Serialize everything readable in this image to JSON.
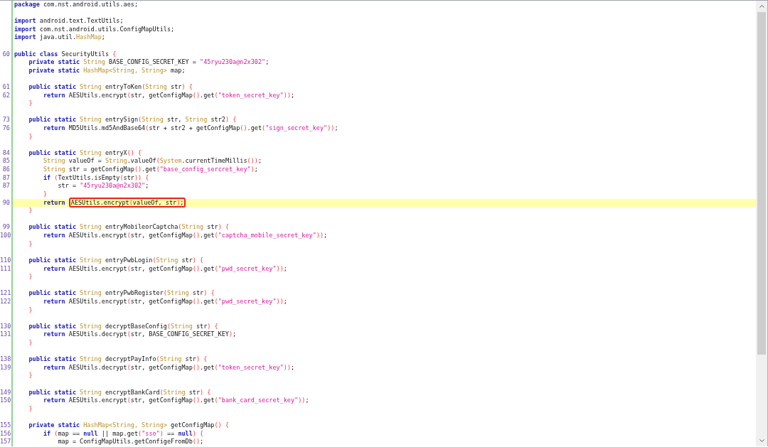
{
  "editor": {
    "blocks": [
      {
        "lines": [
          {
            "highlighted": false,
            "tokens": [
              {
                "kind": "keyword",
                "text": "package"
              },
              {
                "kind": "plain",
                "text": " com.nst.android.utils.aes;"
              }
            ]
          }
        ]
      },
      {
        "lines": [
          {
            "highlighted": false,
            "tokens": [
              {
                "kind": "keyword",
                "text": "import"
              },
              {
                "kind": "plain",
                "text": " android.text.TextUtils;"
              }
            ]
          },
          {
            "highlighted": false,
            "tokens": [
              {
                "kind": "keyword",
                "text": "import"
              },
              {
                "kind": "plain",
                "text": " com.nst.android.utils.ConfigMapUtils;"
              }
            ]
          },
          {
            "highlighted": false,
            "tokens": [
              {
                "kind": "keyword",
                "text": "import"
              },
              {
                "kind": "plain",
                "text": " java.util."
              },
              {
                "kind": "type",
                "text": "HashMap"
              },
              {
                "kind": "plain",
                "text": ";"
              }
            ]
          }
        ]
      },
      {
        "lines": [
          {
            "number": "60",
            "highlighted": false,
            "tokens": [
              {
                "kind": "keyword",
                "text": "public class"
              },
              {
                "kind": "plain",
                "text": " SecurityUtils "
              },
              {
                "kind": "bracket",
                "text": "{"
              }
            ]
          },
          {
            "highlighted": false,
            "tokens": [
              {
                "kind": "keyword",
                "text": "    private static"
              },
              {
                "kind": "type",
                "text": " String"
              },
              {
                "kind": "plain",
                "text": " BASE_CONFIG_SECRET_KEY = "
              },
              {
                "kind": "string",
                "text": "\"45ryu230a@n2x302\""
              },
              {
                "kind": "plain",
                "text": ";"
              }
            ]
          },
          {
            "highlighted": false,
            "tokens": [
              {
                "kind": "keyword",
                "text": "    private static"
              },
              {
                "kind": "type",
                "text": " HashMap<String, String>"
              },
              {
                "kind": "plain",
                "text": " map;"
              }
            ]
          }
        ]
      },
      {
        "lines": [
          {
            "number": "61",
            "highlighted": false,
            "tokens": [
              {
                "kind": "keyword",
                "text": "    public static"
              },
              {
                "kind": "type",
                "text": " String"
              },
              {
                "kind": "plain",
                "text": " entryToKen"
              },
              {
                "kind": "bracket",
                "text": "("
              },
              {
                "kind": "type",
                "text": "String"
              },
              {
                "kind": "plain",
                "text": " str"
              },
              {
                "kind": "bracket",
                "text": ") {"
              }
            ]
          },
          {
            "number": "62",
            "highlighted": false,
            "tokens": [
              {
                "kind": "keyword",
                "text": "        return"
              },
              {
                "kind": "plain",
                "text": " AESUtils.encrypt"
              },
              {
                "kind": "bracket",
                "text": "("
              },
              {
                "kind": "plain",
                "text": "str, getConfigMap"
              },
              {
                "kind": "bracket",
                "text": "()"
              },
              {
                "kind": "plain",
                "text": ".get"
              },
              {
                "kind": "bracket",
                "text": "("
              },
              {
                "kind": "string",
                "text": "\"token_secret_key\""
              },
              {
                "kind": "bracket",
                "text": "))"
              },
              {
                "kind": "plain",
                "text": ";"
              }
            ]
          },
          {
            "highlighted": false,
            "tokens": [
              {
                "kind": "bracket",
                "text": "    }"
              }
            ]
          }
        ]
      },
      {
        "lines": [
          {
            "number": "73",
            "highlighted": false,
            "tokens": [
              {
                "kind": "keyword",
                "text": "    public static"
              },
              {
                "kind": "type",
                "text": " String"
              },
              {
                "kind": "plain",
                "text": " entrySign"
              },
              {
                "kind": "bracket",
                "text": "("
              },
              {
                "kind": "type",
                "text": "String"
              },
              {
                "kind": "plain",
                "text": " str, "
              },
              {
                "kind": "type",
                "text": "String"
              },
              {
                "kind": "plain",
                "text": " str2"
              },
              {
                "kind": "bracket",
                "text": ") {"
              }
            ]
          },
          {
            "number": "76",
            "highlighted": false,
            "tokens": [
              {
                "kind": "keyword",
                "text": "        return"
              },
              {
                "kind": "plain",
                "text": " MD5Utils.md5AndBase64"
              },
              {
                "kind": "bracket",
                "text": "("
              },
              {
                "kind": "plain",
                "text": "str + str2 + getConfigMap"
              },
              {
                "kind": "bracket",
                "text": "()"
              },
              {
                "kind": "plain",
                "text": ".get"
              },
              {
                "kind": "bracket",
                "text": "("
              },
              {
                "kind": "string",
                "text": "\"sign_secret_key\""
              },
              {
                "kind": "bracket",
                "text": "))"
              },
              {
                "kind": "plain",
                "text": ";"
              }
            ]
          },
          {
            "highlighted": false,
            "tokens": [
              {
                "kind": "bracket",
                "text": "    }"
              }
            ]
          }
        ]
      },
      {
        "lines": [
          {
            "number": "84",
            "highlighted": false,
            "tokens": [
              {
                "kind": "keyword",
                "text": "    public static"
              },
              {
                "kind": "type",
                "text": " String"
              },
              {
                "kind": "plain",
                "text": " entryX"
              },
              {
                "kind": "bracket",
                "text": "() {"
              }
            ]
          },
          {
            "number": "85",
            "highlighted": false,
            "tokens": [
              {
                "kind": "type",
                "text": "        String"
              },
              {
                "kind": "plain",
                "text": " valueOf = "
              },
              {
                "kind": "type",
                "text": "String"
              },
              {
                "kind": "plain",
                "text": ".valueOf"
              },
              {
                "kind": "bracket",
                "text": "("
              },
              {
                "kind": "type",
                "text": "System"
              },
              {
                "kind": "plain",
                "text": ".currentTimeMillis"
              },
              {
                "kind": "bracket",
                "text": "())"
              },
              {
                "kind": "plain",
                "text": ";"
              }
            ]
          },
          {
            "number": "86",
            "highlighted": false,
            "tokens": [
              {
                "kind": "type",
                "text": "        String"
              },
              {
                "kind": "plain",
                "text": " str = getConfigMap"
              },
              {
                "kind": "bracket",
                "text": "()"
              },
              {
                "kind": "plain",
                "text": ".get"
              },
              {
                "kind": "bracket",
                "text": "("
              },
              {
                "kind": "string",
                "text": "\"base_config_sercret_key\""
              },
              {
                "kind": "bracket",
                "text": ")"
              },
              {
                "kind": "plain",
                "text": ";"
              }
            ]
          },
          {
            "number": "87",
            "highlighted": false,
            "tokens": [
              {
                "kind": "keyword",
                "text": "        if"
              },
              {
                "kind": "bracket",
                "text": " ("
              },
              {
                "kind": "plain",
                "text": "TextUtils.isEmpty"
              },
              {
                "kind": "bracket",
                "text": "("
              },
              {
                "kind": "plain",
                "text": "str"
              },
              {
                "kind": "bracket",
                "text": ")) {"
              }
            ]
          },
          {
            "number": "87",
            "highlighted": false,
            "tokens": [
              {
                "kind": "plain",
                "text": "            str = "
              },
              {
                "kind": "string",
                "text": "\"45ryu230a@n2x302\""
              },
              {
                "kind": "plain",
                "text": ";"
              }
            ]
          },
          {
            "highlighted": false,
            "tokens": [
              {
                "kind": "bracket",
                "text": "        }"
              }
            ]
          },
          {
            "number": "90",
            "highlighted": true,
            "tokens": [
              {
                "kind": "keyword",
                "text": "        return "
              }
            ],
            "boxed_tokens": [
              {
                "kind": "plain",
                "text": "AESUtils.encrypt"
              },
              {
                "kind": "bracket",
                "text": "("
              },
              {
                "kind": "plain",
                "text": "valueOf, str"
              },
              {
                "kind": "bracket",
                "text": ")"
              },
              {
                "kind": "plain",
                "text": ";"
              }
            ]
          },
          {
            "highlighted": false,
            "tokens": [
              {
                "kind": "bracket",
                "text": "    }"
              }
            ]
          }
        ]
      },
      {
        "lines": [
          {
            "number": "99",
            "highlighted": false,
            "tokens": [
              {
                "kind": "keyword",
                "text": "    public static"
              },
              {
                "kind": "type",
                "text": " String"
              },
              {
                "kind": "plain",
                "text": " entryMobileorCaptcha"
              },
              {
                "kind": "bracket",
                "text": "("
              },
              {
                "kind": "type",
                "text": "String"
              },
              {
                "kind": "plain",
                "text": " str"
              },
              {
                "kind": "bracket",
                "text": ") {"
              }
            ]
          },
          {
            "number": "100",
            "highlighted": false,
            "tokens": [
              {
                "kind": "keyword",
                "text": "        return"
              },
              {
                "kind": "plain",
                "text": " AESUtils.encrypt"
              },
              {
                "kind": "bracket",
                "text": "("
              },
              {
                "kind": "plain",
                "text": "str, getConfigMap"
              },
              {
                "kind": "bracket",
                "text": "()"
              },
              {
                "kind": "plain",
                "text": ".get"
              },
              {
                "kind": "bracket",
                "text": "("
              },
              {
                "kind": "string",
                "text": "\"captcha_mobile_secret_key\""
              },
              {
                "kind": "bracket",
                "text": "))"
              },
              {
                "kind": "plain",
                "text": ";"
              }
            ]
          },
          {
            "highlighted": false,
            "tokens": [
              {
                "kind": "bracket",
                "text": "    }"
              }
            ]
          }
        ]
      },
      {
        "lines": [
          {
            "number": "110",
            "highlighted": false,
            "tokens": [
              {
                "kind": "keyword",
                "text": "    public static"
              },
              {
                "kind": "type",
                "text": " String"
              },
              {
                "kind": "plain",
                "text": " entryPwbLogin"
              },
              {
                "kind": "bracket",
                "text": "("
              },
              {
                "kind": "type",
                "text": "String"
              },
              {
                "kind": "plain",
                "text": " str"
              },
              {
                "kind": "bracket",
                "text": ") {"
              }
            ]
          },
          {
            "number": "111",
            "highlighted": false,
            "tokens": [
              {
                "kind": "keyword",
                "text": "        return"
              },
              {
                "kind": "plain",
                "text": " AESUtils.encrypt"
              },
              {
                "kind": "bracket",
                "text": "("
              },
              {
                "kind": "plain",
                "text": "str, getConfigMap"
              },
              {
                "kind": "bracket",
                "text": "()"
              },
              {
                "kind": "plain",
                "text": ".get"
              },
              {
                "kind": "bracket",
                "text": "("
              },
              {
                "kind": "string",
                "text": "\"pwd_secret_key\""
              },
              {
                "kind": "bracket",
                "text": "))"
              },
              {
                "kind": "plain",
                "text": ";"
              }
            ]
          },
          {
            "highlighted": false,
            "tokens": [
              {
                "kind": "bracket",
                "text": "    }"
              }
            ]
          }
        ]
      },
      {
        "lines": [
          {
            "number": "121",
            "highlighted": false,
            "tokens": [
              {
                "kind": "keyword",
                "text": "    public static"
              },
              {
                "kind": "type",
                "text": " String"
              },
              {
                "kind": "plain",
                "text": " entryPwbRegister"
              },
              {
                "kind": "bracket",
                "text": "("
              },
              {
                "kind": "type",
                "text": "String"
              },
              {
                "kind": "plain",
                "text": " str"
              },
              {
                "kind": "bracket",
                "text": ") {"
              }
            ]
          },
          {
            "number": "122",
            "highlighted": false,
            "tokens": [
              {
                "kind": "keyword",
                "text": "        return"
              },
              {
                "kind": "plain",
                "text": " AESUtils.encrypt"
              },
              {
                "kind": "bracket",
                "text": "("
              },
              {
                "kind": "plain",
                "text": "str, getConfigMap"
              },
              {
                "kind": "bracket",
                "text": "()"
              },
              {
                "kind": "plain",
                "text": ".get"
              },
              {
                "kind": "bracket",
                "text": "("
              },
              {
                "kind": "string",
                "text": "\"pwd_secret_key\""
              },
              {
                "kind": "bracket",
                "text": "))"
              },
              {
                "kind": "plain",
                "text": ";"
              }
            ]
          },
          {
            "highlighted": false,
            "tokens": [
              {
                "kind": "bracket",
                "text": "    }"
              }
            ]
          }
        ]
      },
      {
        "lines": [
          {
            "number": "130",
            "highlighted": false,
            "tokens": [
              {
                "kind": "keyword",
                "text": "    public static"
              },
              {
                "kind": "type",
                "text": " String"
              },
              {
                "kind": "plain",
                "text": " decryptBaseConfig"
              },
              {
                "kind": "bracket",
                "text": "("
              },
              {
                "kind": "type",
                "text": "String"
              },
              {
                "kind": "plain",
                "text": " str"
              },
              {
                "kind": "bracket",
                "text": ") {"
              }
            ]
          },
          {
            "number": "131",
            "highlighted": false,
            "tokens": [
              {
                "kind": "keyword",
                "text": "        return"
              },
              {
                "kind": "plain",
                "text": " AESUtils.decrypt"
              },
              {
                "kind": "bracket",
                "text": "("
              },
              {
                "kind": "plain",
                "text": "str, BASE_CONFIG_SECRET_KEY"
              },
              {
                "kind": "bracket",
                "text": ")"
              },
              {
                "kind": "plain",
                "text": ";"
              }
            ]
          },
          {
            "highlighted": false,
            "tokens": [
              {
                "kind": "bracket",
                "text": "    }"
              }
            ]
          }
        ]
      },
      {
        "lines": [
          {
            "number": "138",
            "highlighted": false,
            "tokens": [
              {
                "kind": "keyword",
                "text": "    public static"
              },
              {
                "kind": "type",
                "text": " String"
              },
              {
                "kind": "plain",
                "text": " decryptPayInfo"
              },
              {
                "kind": "bracket",
                "text": "("
              },
              {
                "kind": "type",
                "text": "String"
              },
              {
                "kind": "plain",
                "text": " str"
              },
              {
                "kind": "bracket",
                "text": ") {"
              }
            ]
          },
          {
            "number": "139",
            "highlighted": false,
            "tokens": [
              {
                "kind": "keyword",
                "text": "        return"
              },
              {
                "kind": "plain",
                "text": " AESUtils.decrypt"
              },
              {
                "kind": "bracket",
                "text": "("
              },
              {
                "kind": "plain",
                "text": "str, getConfigMap"
              },
              {
                "kind": "bracket",
                "text": "()"
              },
              {
                "kind": "plain",
                "text": ".get"
              },
              {
                "kind": "bracket",
                "text": "("
              },
              {
                "kind": "string",
                "text": "\"token_secret_key\""
              },
              {
                "kind": "bracket",
                "text": "))"
              },
              {
                "kind": "plain",
                "text": ";"
              }
            ]
          },
          {
            "highlighted": false,
            "tokens": [
              {
                "kind": "bracket",
                "text": "    }"
              }
            ]
          }
        ]
      },
      {
        "lines": [
          {
            "number": "149",
            "highlighted": false,
            "tokens": [
              {
                "kind": "keyword",
                "text": "    public static"
              },
              {
                "kind": "type",
                "text": " String"
              },
              {
                "kind": "plain",
                "text": " encryptBankCard"
              },
              {
                "kind": "bracket",
                "text": "("
              },
              {
                "kind": "type",
                "text": "String"
              },
              {
                "kind": "plain",
                "text": " str"
              },
              {
                "kind": "bracket",
                "text": ") {"
              }
            ]
          },
          {
            "number": "150",
            "highlighted": false,
            "tokens": [
              {
                "kind": "keyword",
                "text": "        return"
              },
              {
                "kind": "plain",
                "text": " AESUtils.encrypt"
              },
              {
                "kind": "bracket",
                "text": "("
              },
              {
                "kind": "plain",
                "text": "str, getConfigMap"
              },
              {
                "kind": "bracket",
                "text": "()"
              },
              {
                "kind": "plain",
                "text": ".get"
              },
              {
                "kind": "bracket",
                "text": "("
              },
              {
                "kind": "string",
                "text": "\"bank_card_secret_key\""
              },
              {
                "kind": "bracket",
                "text": "))"
              },
              {
                "kind": "plain",
                "text": ";"
              }
            ]
          },
          {
            "highlighted": false,
            "tokens": [
              {
                "kind": "bracket",
                "text": "    }"
              }
            ]
          }
        ]
      },
      {
        "lines": [
          {
            "number": "155",
            "highlighted": false,
            "tokens": [
              {
                "kind": "keyword",
                "text": "    private static"
              },
              {
                "kind": "type",
                "text": " HashMap<String, String>"
              },
              {
                "kind": "plain",
                "text": " getConfigMap"
              },
              {
                "kind": "bracket",
                "text": "() {"
              }
            ]
          },
          {
            "number": "156",
            "highlighted": false,
            "tokens": [
              {
                "kind": "keyword",
                "text": "        if"
              },
              {
                "kind": "bracket",
                "text": " ("
              },
              {
                "kind": "plain",
                "text": "map == "
              },
              {
                "kind": "keyword",
                "text": "null"
              },
              {
                "kind": "plain",
                "text": " || map.get"
              },
              {
                "kind": "bracket",
                "text": "("
              },
              {
                "kind": "string",
                "text": "\"sso\""
              },
              {
                "kind": "bracket",
                "text": ")"
              },
              {
                "kind": "plain",
                "text": " == "
              },
              {
                "kind": "keyword",
                "text": "null"
              },
              {
                "kind": "bracket",
                "text": ") {"
              }
            ]
          },
          {
            "number": "157",
            "highlighted": false,
            "tokens": [
              {
                "kind": "plain",
                "text": "            map = ConfigMapUtils.getConfigeFromDb"
              },
              {
                "kind": "bracket",
                "text": "()"
              },
              {
                "kind": "plain",
                "text": ";"
              }
            ]
          }
        ]
      }
    ]
  }
}
